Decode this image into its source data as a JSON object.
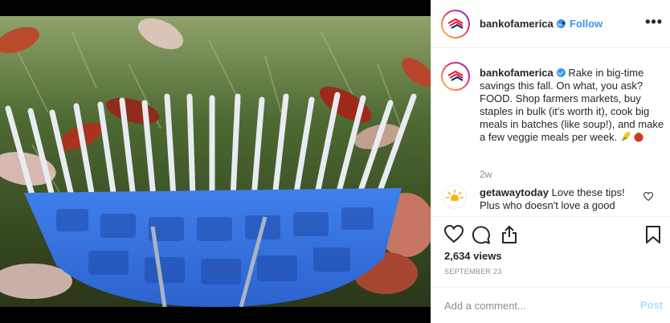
{
  "post": {
    "username": "bankofamerica",
    "follow_label": "Follow",
    "separator": "•",
    "more_label": "•••"
  },
  "caption": {
    "username": "bankofamerica",
    "text": "Rake in big-time savings this fall. On what, you ask? FOOD. Shop farmers markets, buy staples in bulk (it's worth it), cook big meals in batches (like soup!), and make a few veggie meals per week.",
    "emojis": [
      "corn-emoji",
      "tomato-emoji"
    ],
    "time_ago": "2w"
  },
  "comment": {
    "username": "getawaytoday",
    "text": "Love these tips! Plus who doesn't love a good"
  },
  "stats": {
    "views": "2,634 views",
    "date": "SEPTEMBER 23"
  },
  "composer": {
    "placeholder": "Add a comment...",
    "post_label": "Post"
  },
  "colors": {
    "accent": "#3897f0",
    "brand_red": "#e31837",
    "text": "#262626",
    "muted": "#8e8e8e",
    "post_disabled": "#b3dbff"
  }
}
